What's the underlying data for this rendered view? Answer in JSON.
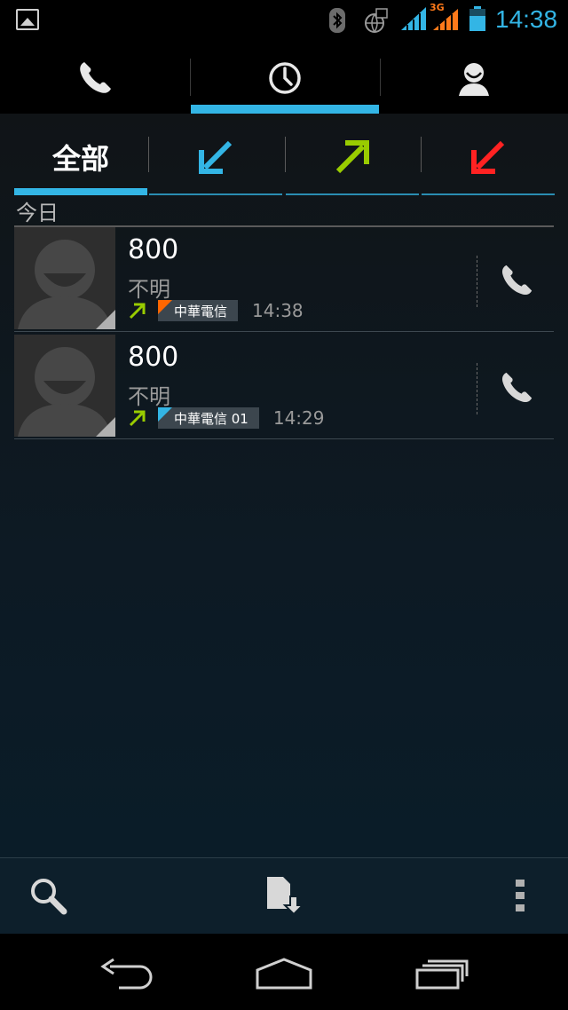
{
  "status_bar": {
    "time": "14:38",
    "icons": [
      "gallery-icon",
      "bluetooth-icon",
      "data-sync-icon",
      "signal-icon",
      "signal-3g-icon",
      "battery-icon"
    ],
    "accent": "#33b5e5",
    "network_3g_label": "3G"
  },
  "action_tabs": [
    {
      "name": "phone-tab",
      "icon": "phone-icon",
      "selected": false
    },
    {
      "name": "call-log-tab",
      "icon": "clock-icon",
      "selected": true
    },
    {
      "name": "contacts-tab",
      "icon": "person-icon",
      "selected": false
    }
  ],
  "filter_tabs": [
    {
      "label": "全部",
      "selected": true
    },
    {
      "icon": "incoming-call-arrow-icon",
      "color": "#33b5e5"
    },
    {
      "icon": "outgoing-call-arrow-icon",
      "color": "#99cc00"
    },
    {
      "icon": "missed-call-arrow-icon",
      "color": "#ff2222"
    }
  ],
  "section_header": "今日",
  "calls": [
    {
      "number": "800",
      "label": "不明",
      "type": "outgoing",
      "carrier": "中華電信",
      "carrier_color": "#ff6600",
      "time": "14:38"
    },
    {
      "number": "800",
      "label": "不明",
      "type": "outgoing",
      "carrier": "中華電信 01",
      "carrier_color": "#33b5e5",
      "time": "14:29"
    }
  ],
  "bottom_bar": [
    "search-icon",
    "import-sim-icon",
    "overflow-menu-icon"
  ],
  "nav_bar": [
    "back-icon",
    "home-icon",
    "recent-apps-icon"
  ]
}
